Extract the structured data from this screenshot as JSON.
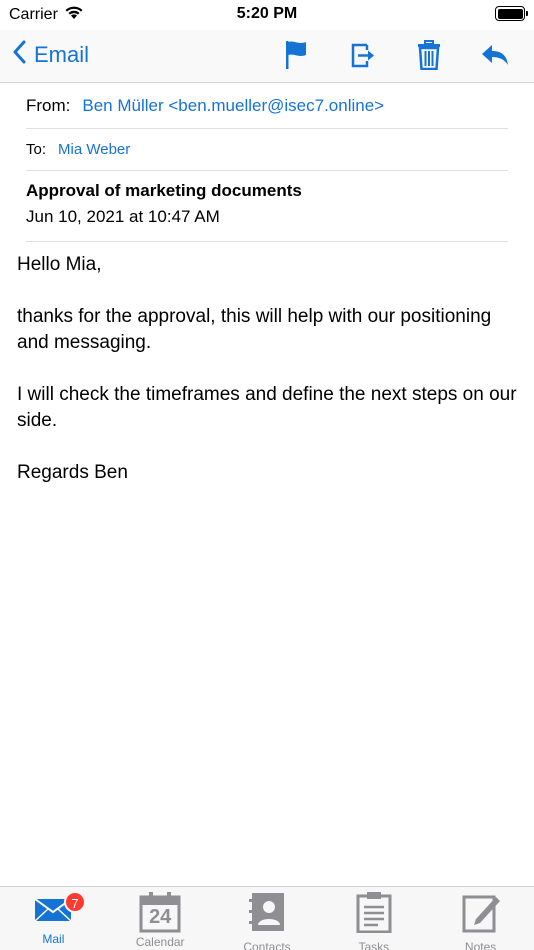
{
  "status_bar": {
    "carrier": "Carrier",
    "time": "5:20 PM"
  },
  "nav": {
    "back_label": "Email"
  },
  "header": {
    "from_label": "From:",
    "from_value": "Ben Müller <ben.mueller@isec7.online>",
    "to_label": "To:",
    "to_value": "Mia Weber",
    "subject": "Approval of marketing documents",
    "date": "Jun 10, 2021 at 10:47 AM"
  },
  "body": {
    "greeting": "Hello Mia,",
    "paragraph1": "thanks for the approval, this will help with our positioning and messaging.",
    "paragraph2": "I will check the timeframes and define the next steps on our side.",
    "signoff": "Regards Ben"
  },
  "tabs": [
    {
      "label": "Mail",
      "badge": "7",
      "icon": "mail-icon"
    },
    {
      "label": "Calendar",
      "icon": "calendar-icon",
      "day": "24"
    },
    {
      "label": "Contacts",
      "icon": "contacts-icon"
    },
    {
      "label": "Tasks",
      "icon": "tasks-icon"
    },
    {
      "label": "Notes",
      "icon": "notes-icon"
    }
  ],
  "colors": {
    "accent": "#1673d6",
    "badge": "#ff3b30",
    "inactive": "#8e8e93"
  }
}
